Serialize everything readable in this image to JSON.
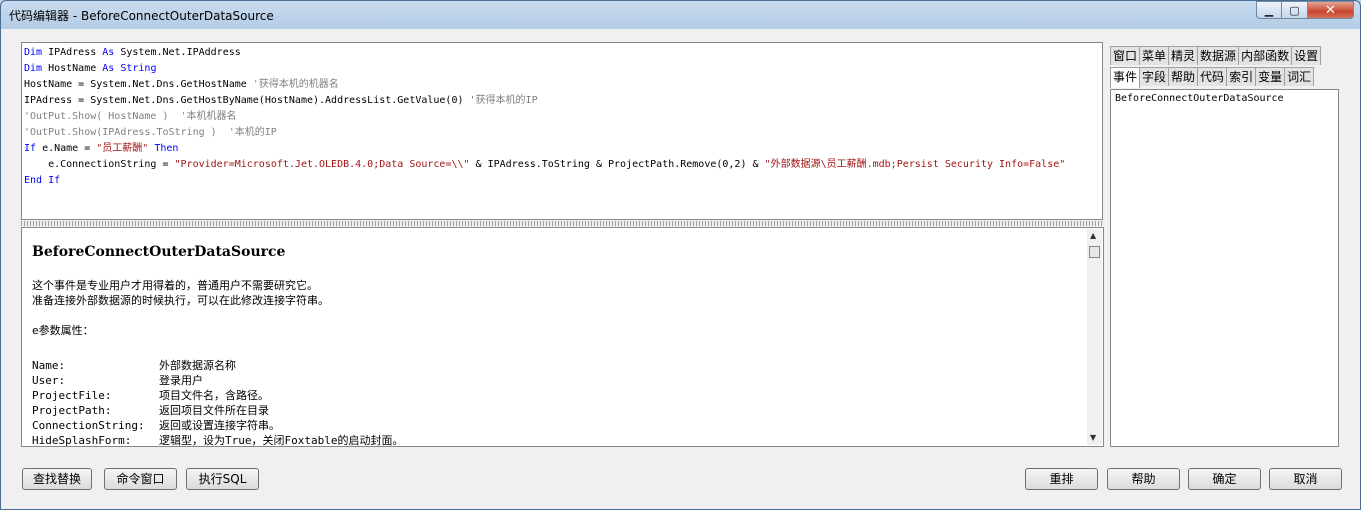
{
  "window": {
    "title": "代码编辑器 - BeforeConnectOuterDataSource",
    "min_glyph": "▁",
    "max_glyph": "▢",
    "close_glyph": "✕"
  },
  "code": {
    "l1": {
      "kw1": "Dim",
      "p1": " IPAdress ",
      "kw2": "As",
      "p2": " System.Net.IPAddress"
    },
    "l2": {
      "kw1": "Dim",
      "p1": " HostName ",
      "kw2": "As String"
    },
    "l3": {
      "p1": "HostName = System.Net.Dns.GetHostName ",
      "cm": "'获得本机的机器名"
    },
    "l4": {
      "p1": "IPAdress = System.Net.Dns.GetHostByName(HostName).AddressList.GetValue(0) ",
      "cm": "'获得本机的IP"
    },
    "l5": {
      "cm": "'OutPut.Show( HostName )  '本机机器名"
    },
    "l6": {
      "cm": "'OutPut.Show(IPAdress.ToString )  '本机的IP"
    },
    "l7": {
      "kw1": "If",
      "p1": " e.Name = ",
      "st": "\"员工薪酬\"",
      "p2": " ",
      "kw2": "Then"
    },
    "l8": {
      "p1": "    e.ConnectionString = ",
      "st1": "\"Provider=Microsoft.Jet.OLEDB.4.0;Data Source=\\\\\"",
      "p2": " & IPAdress.ToString & ProjectPath.Remove(0,2) & ",
      "st2": "\"外部数据源\\员工薪酬.mdb;Persist Security Info=False\""
    },
    "l9": {
      "kw1": "End If"
    }
  },
  "help": {
    "title": "BeforeConnectOuterDataSource",
    "para1": "这个事件是专业用户才用得着的，普通用户不需要研究它。",
    "para2": "准备连接外部数据源的时候执行，可以在此修改连接字符串。",
    "params_heading": "e参数属性：",
    "props": [
      {
        "name": "Name:",
        "desc": "外部数据源名称"
      },
      {
        "name": "User:",
        "desc": "登录用户"
      },
      {
        "name": "ProjectFile:",
        "desc": "项目文件名，含路径。"
      },
      {
        "name": "ProjectPath:",
        "desc": "返回项目文件所在目录"
      },
      {
        "name": "ConnectionString:",
        "desc": "返回或设置连接字符串。"
      },
      {
        "name": "HideSplashForm:",
        "desc": "逻辑型，设为True，关闭Foxtable的启动封面。"
      }
    ]
  },
  "tabs": {
    "row1": [
      "窗口",
      "菜单",
      "精灵",
      "数据源",
      "内部函数",
      "设置"
    ],
    "row2": [
      "事件",
      "字段",
      "帮助",
      "代码",
      "索引",
      "变量",
      "词汇"
    ]
  },
  "list": {
    "items": [
      "BeforeConnectOuterDataSource"
    ]
  },
  "buttons": {
    "find_replace": "查找替换",
    "command_window": "命令窗口",
    "execute_sql": "执行SQL",
    "reorder": "重排",
    "help": "帮助",
    "ok": "确定",
    "cancel": "取消"
  }
}
